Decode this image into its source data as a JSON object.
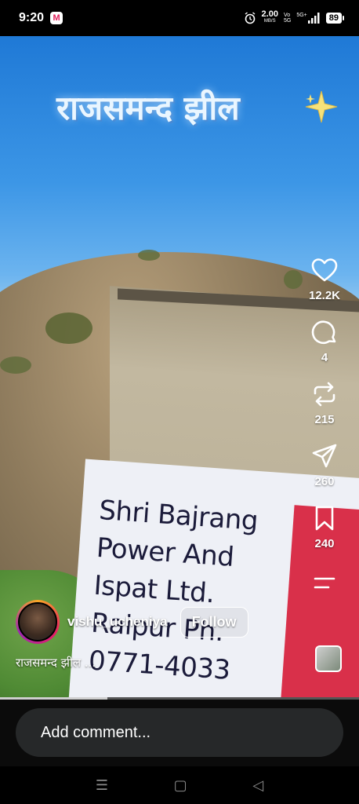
{
  "status": {
    "time": "9:20",
    "app_badge": "M",
    "speed_value": "2.00",
    "speed_unit": "MB/S",
    "volte_top": "Vo",
    "volte_bottom": "5G",
    "network": "5G+",
    "battery": "89"
  },
  "post": {
    "overlay_title": "राजसमन्द झील",
    "sign_lines": [
      "Shri Bajrang",
      "Power And",
      "Ispat Ltd.",
      "Raipur Ph.",
      "0771-4033"
    ],
    "username": "vishu_ucheniya",
    "follow_label": "Follow",
    "caption": "राजसमन्द झील ...",
    "progress": 0.3
  },
  "actions": {
    "likes": "12.2K",
    "comments": "4",
    "reposts": "215",
    "shares": "260",
    "saves": "240"
  },
  "comment": {
    "placeholder": "Add comment..."
  },
  "nav": {
    "menu": "☰",
    "home": "▢",
    "back": "◁"
  },
  "colors": {
    "follow_border": "#ffffff",
    "comment_bg": "#262829",
    "sign_red": "#d9304a"
  }
}
